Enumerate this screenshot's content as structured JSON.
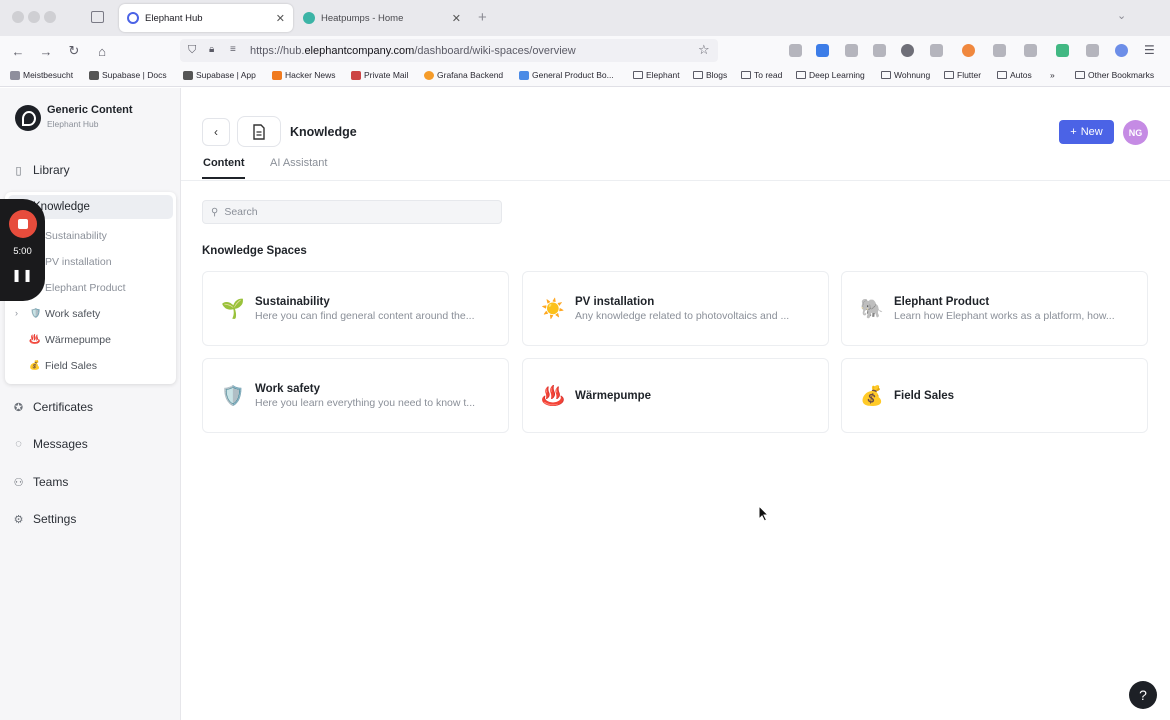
{
  "browser": {
    "tabs": [
      {
        "label": "Elephant Hub",
        "active": true
      },
      {
        "label": "Heatpumps - Home",
        "active": false
      }
    ],
    "url_prefix": "https://hub.",
    "url_domain": "elephantcompany.com",
    "url_path": "/dashboard/wiki-spaces/overview",
    "bookmarks": [
      "Meistbesucht",
      "Supabase | Docs",
      "Supabase | App",
      "Hacker News",
      "Private Mail",
      "Grafana Backend",
      "General Product Bo...",
      "Elephant",
      "Blogs",
      "To read",
      "Deep Learning",
      "Wohnung",
      "Flutter",
      "Autos",
      "Other Bookmarks"
    ]
  },
  "sidebar": {
    "brand_title": "Generic Content",
    "brand_subtitle": "Elephant Hub",
    "library": "Library",
    "knowledge": "Knowledge",
    "sub_items": [
      "Sustainability",
      "PV installation",
      "Elephant Product",
      "Work safety",
      "Wärmepumpe",
      "Field Sales"
    ],
    "sub_icons": [
      "",
      "",
      "",
      "🛡️",
      "♨️",
      "💰"
    ],
    "certificates": "Certificates",
    "messages": "Messages",
    "teams": "Teams",
    "settings": "Settings"
  },
  "recorder": {
    "time": "5:00"
  },
  "header": {
    "title": "Knowledge",
    "tabs": [
      "Content",
      "AI Assistant"
    ],
    "new_button": "New",
    "avatar": "NG"
  },
  "search": {
    "placeholder": "Search"
  },
  "section_title": "Knowledge Spaces",
  "spaces": [
    {
      "icon": "🌱",
      "title": "Sustainability",
      "desc": "Here you can find general content around the..."
    },
    {
      "icon": "☀️",
      "title": "PV installation",
      "desc": "Any knowledge related to photovoltaics and ..."
    },
    {
      "icon": "🐘",
      "title": "Elephant Product",
      "desc": "Learn how Elephant works as a platform, how..."
    },
    {
      "icon": "🛡️",
      "title": "Work safety",
      "desc": "Here you learn everything you need to know t..."
    },
    {
      "icon": "♨️",
      "title": "Wärmepumpe",
      "desc": ""
    },
    {
      "icon": "💰",
      "title": "Field Sales",
      "desc": ""
    }
  ],
  "help": "?"
}
